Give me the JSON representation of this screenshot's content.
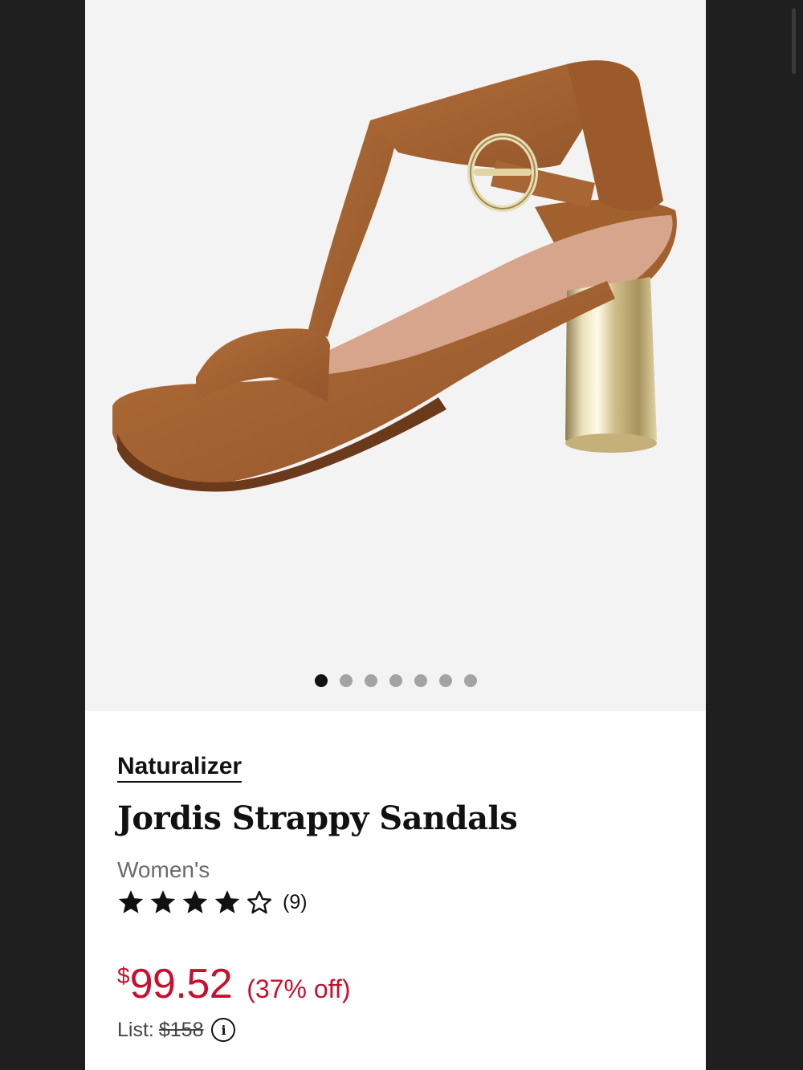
{
  "product": {
    "brand": "Naturalizer",
    "title": "Jordis Strappy Sandals",
    "gender": "Women's",
    "rating": 4,
    "rating_max": 5,
    "review_count": "(9)",
    "price_symbol": "$",
    "price_value": "99.52",
    "discount": "(37% off)",
    "list_label": "List:",
    "list_price": "$158",
    "info_icon": "i"
  },
  "gallery": {
    "image": "tan-suede-t-strap-heeled-sandal",
    "image_count": 7,
    "active_index": 0
  },
  "colors": {
    "price_red": "#c8102e",
    "gallery_bg": "#f3f3f3",
    "suede": "#a4622f"
  }
}
